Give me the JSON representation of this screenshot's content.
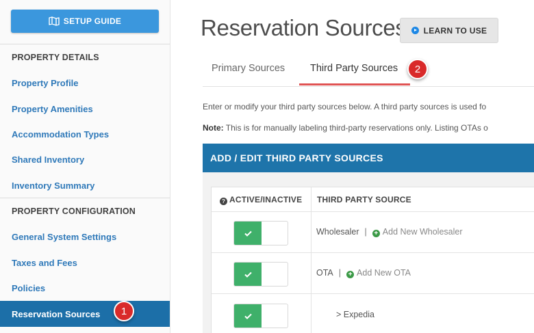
{
  "sidebar": {
    "setup_guide_label": "SETUP GUIDE",
    "property_details_title": "PROPERTY DETAILS",
    "details_items": [
      {
        "label": "Property Profile"
      },
      {
        "label": "Property Amenities"
      },
      {
        "label": "Accommodation Types"
      },
      {
        "label": "Shared Inventory"
      },
      {
        "label": "Inventory Summary"
      }
    ],
    "property_config_title": "PROPERTY CONFIGURATION",
    "config_items": [
      {
        "label": "General System Settings"
      },
      {
        "label": "Taxes and Fees"
      },
      {
        "label": "Policies"
      },
      {
        "label": "Reservation Sources"
      }
    ]
  },
  "header": {
    "title": "Reservation Sources",
    "learn_label": "LEARN TO USE"
  },
  "tabs": [
    {
      "label": "Primary Sources"
    },
    {
      "label": "Third Party Sources"
    }
  ],
  "content": {
    "description": "Enter or modify your third party sources below. A third party sources is used fo",
    "note_label": "Note:",
    "note_text": "This is for manually labeling third-party reservations only. Listing OTAs o"
  },
  "panel": {
    "title": "ADD / EDIT THIRD PARTY SOURCES",
    "col_active": "ACTIVE/INACTIVE",
    "col_source": "THIRD PARTY SOURCE",
    "rows": [
      {
        "name": "Wholesaler",
        "separator": "|",
        "add_label": "Add New Wholesaler",
        "active": true
      },
      {
        "name": "OTA",
        "separator": "|",
        "add_label": "Add New OTA",
        "active": true
      },
      {
        "name": "> Expedia",
        "active": true
      }
    ]
  },
  "annotations": {
    "badge_1": "1",
    "badge_2": "2"
  },
  "colors": {
    "accent_blue": "#1e74aa",
    "link_blue": "#2f79b9",
    "toggle_green": "#3fb06a",
    "tab_underline": "#e05353",
    "badge_red": "#d92a2a"
  }
}
